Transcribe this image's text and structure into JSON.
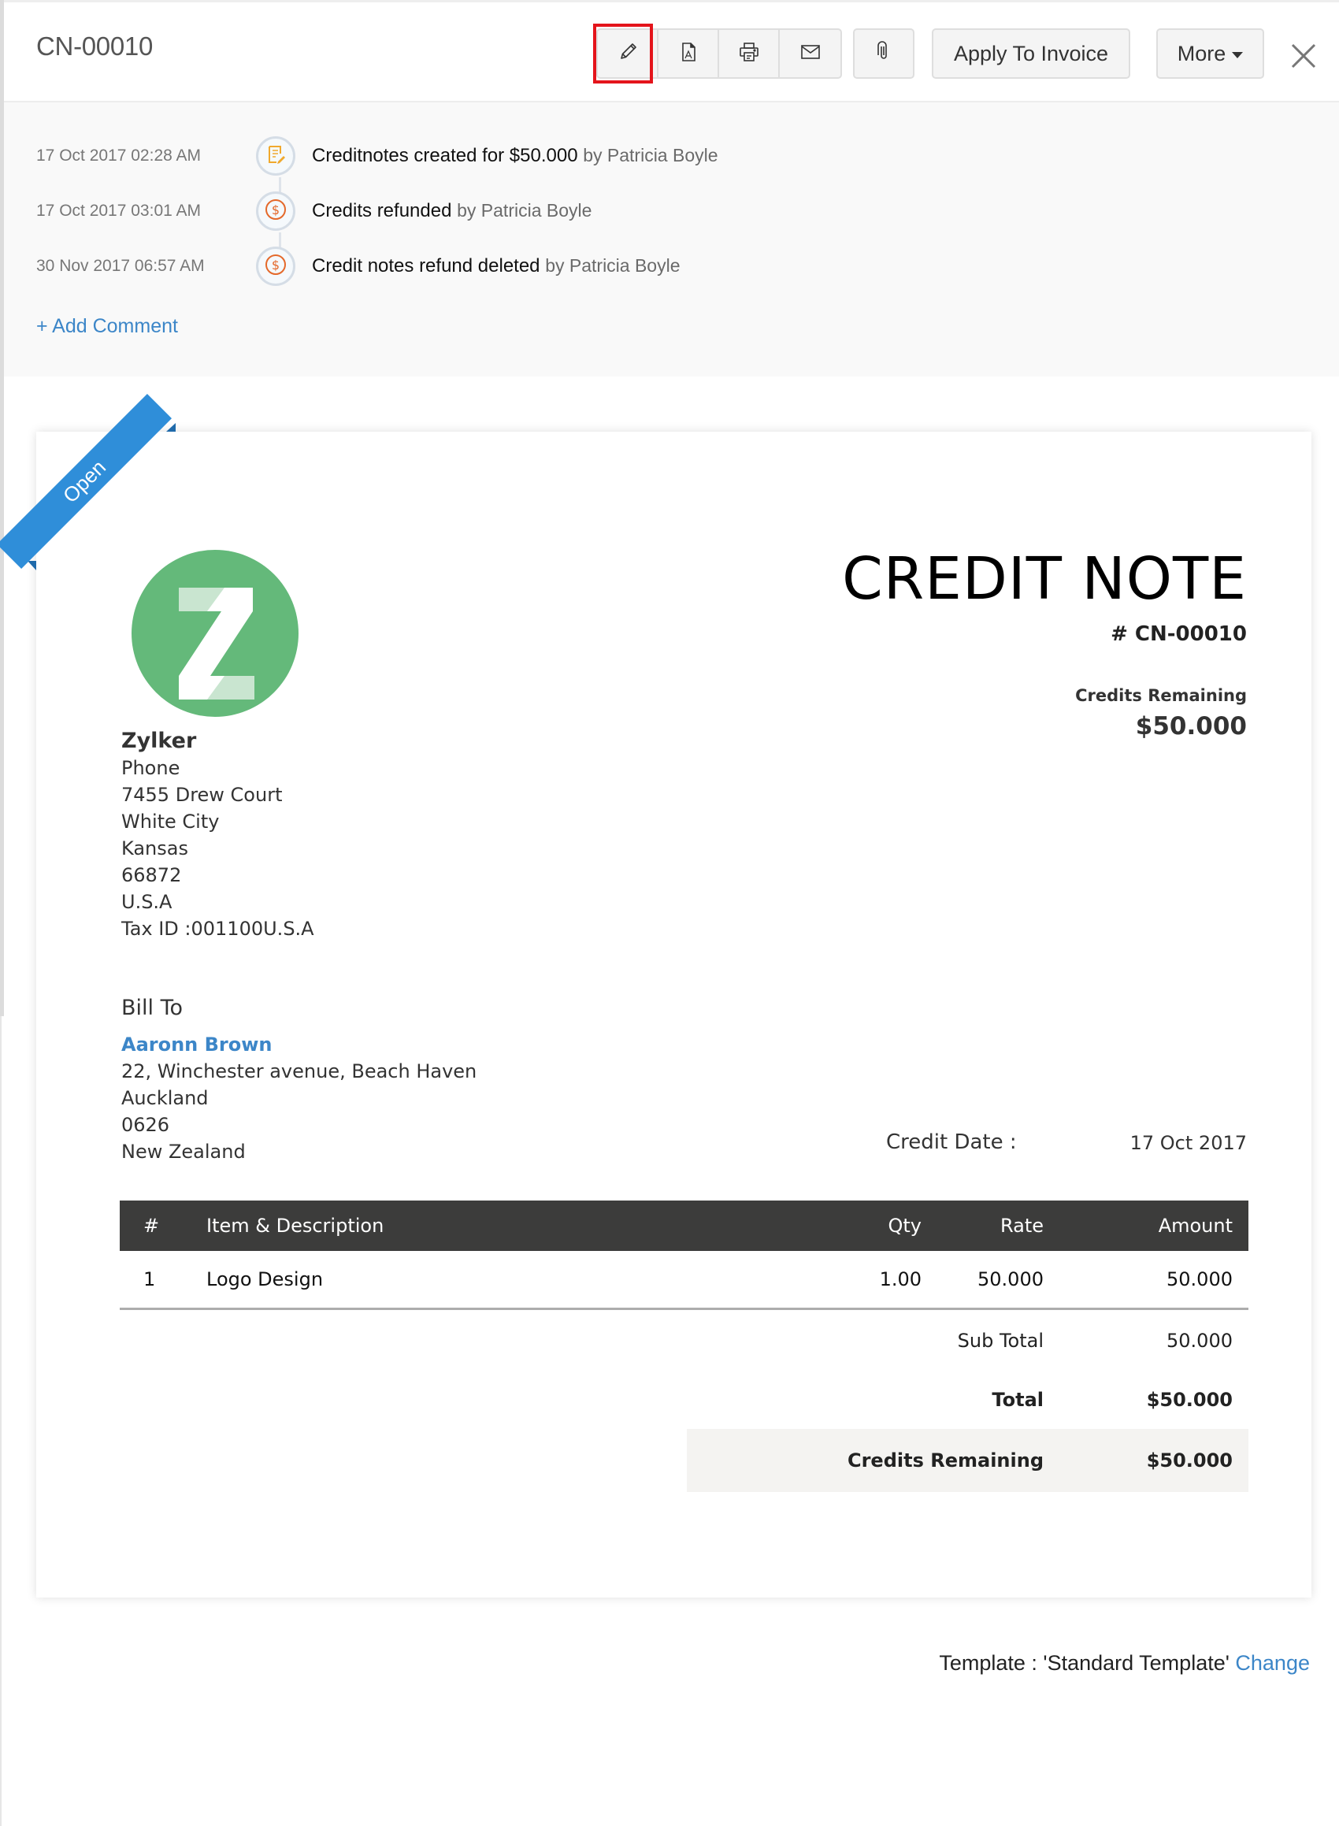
{
  "header": {
    "title": "CN-00010",
    "toolbar": {
      "edit_icon": "pencil-icon",
      "pdf_icon": "pdf-icon",
      "print_icon": "printer-icon",
      "email_icon": "envelope-icon",
      "attach_icon": "paperclip-icon",
      "apply_label": "Apply To Invoice",
      "more_label": "More",
      "close_icon": "close-icon"
    },
    "highlight_color": "#e4141b"
  },
  "activity": {
    "items": [
      {
        "date": "17 Oct 2017 02:28 AM",
        "icon": "note-edit-icon",
        "text": "Creditnotes created for $50.000",
        "by": "by Patricia Boyle",
        "icon_color": "#f0a92e"
      },
      {
        "date": "17 Oct 2017 03:01 AM",
        "icon": "dollar-icon",
        "text": "Credits refunded",
        "by": "by Patricia Boyle",
        "icon_color": "#e4692b"
      },
      {
        "date": "30 Nov 2017 06:57 AM",
        "icon": "dollar-icon",
        "text": "Credit notes refund deleted",
        "by": "by Patricia Boyle",
        "icon_color": "#e4692b"
      }
    ],
    "add_comment": "+ Add Comment"
  },
  "document": {
    "status_ribbon": "Open",
    "status_color": "#2f8ed9",
    "title": "CREDIT NOTE",
    "number": "# CN-00010",
    "credits_remaining_label": "Credits Remaining",
    "credits_remaining_value": "$50.000",
    "logo_letter": "Z",
    "logo_color": "#64b97a",
    "org": {
      "name": "Zylker",
      "lines": [
        "Phone",
        "7455 Drew Court",
        "White City",
        "Kansas",
        "66872",
        "U.S.A",
        "Tax ID :001100U.S.A"
      ]
    },
    "bill_to": {
      "heading": "Bill To",
      "name": "Aaronn Brown",
      "lines": [
        "22, Winchester avenue, Beach Haven",
        "Auckland",
        "0626",
        "New Zealand"
      ]
    },
    "credit_date_label": "Credit Date :",
    "credit_date_value": "17 Oct 2017",
    "table": {
      "headers": {
        "num": "#",
        "desc": "Item & Description",
        "qty": "Qty",
        "rate": "Rate",
        "amount": "Amount"
      },
      "rows": [
        {
          "num": "1",
          "desc": "Logo Design",
          "qty": "1.00",
          "rate": "50.000",
          "amount": "50.000"
        }
      ]
    },
    "totals": {
      "sub_total_label": "Sub Total",
      "sub_total_value": "50.000",
      "total_label": "Total",
      "total_value": "$50.000",
      "credits_remaining_label": "Credits Remaining",
      "credits_remaining_value": "$50.000"
    }
  },
  "footer": {
    "template_text": "Template : 'Standard Template'",
    "change_label": "Change"
  }
}
